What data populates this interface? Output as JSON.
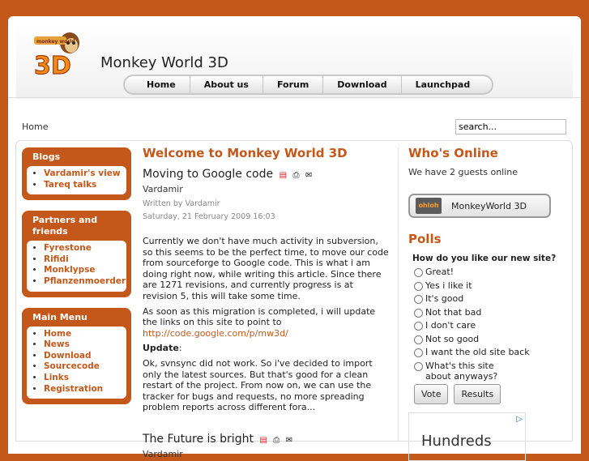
{
  "site": {
    "title": "Monkey World 3D",
    "logo_text": "3D"
  },
  "nav": [
    "Home",
    "About us",
    "Forum",
    "Download",
    "Launchpad"
  ],
  "breadcrumb": "Home",
  "search": {
    "value": "search..."
  },
  "left": {
    "blogs": {
      "title": "Blogs",
      "items": [
        "Vardamir's view",
        "Tareq talks"
      ]
    },
    "partners": {
      "title": "Partners and friends",
      "items": [
        "Fyrestone",
        "Rifidi",
        "Monklypse",
        "Pflanzenmoerder"
      ]
    },
    "menu": {
      "title": "Main Menu",
      "items": [
        "Home",
        "News",
        "Download",
        "Sourcecode",
        "Links",
        "Registration"
      ]
    }
  },
  "main": {
    "heading": "Welcome to Monkey World 3D",
    "article1": {
      "title": "Moving to Google code",
      "author": "Vardamir",
      "written_by": "Written by Vardamir",
      "date": "Saturday, 21 February 2009 16:03",
      "p1": "Currently we don't have much activity in subversion, so this seems to be the perfect time, to move our code from sourceforge to Google code. This is what i am doing right now, while writing this article. Since there are 1271 revisions, and currently progress is at revision 5, this will take some time.",
      "p2_text": "As soon as this migration is completed, i will update the links on this site to point to ",
      "p2_link": "http://code.google.com/p/mw3d/",
      "update_label": "Update",
      "update_colon": ":",
      "p3": "Ok, svnsync did not work. So i've decided to import  only the latest sources. But that's good for a clean restart of the project. From now on, we can use the tracker for bugs and requests, no more spreading problem reports across different fora..."
    },
    "article2": {
      "title": "The Future is bright",
      "author": "Vardamir"
    }
  },
  "right": {
    "online_title": "Who's Online",
    "online_text": "We have 2 guests online",
    "online_button": "MonkeyWorld 3D",
    "online_button_icon": "ohloh",
    "polls_title": "Polls",
    "poll_question": "How do you like our new site?",
    "poll_options": [
      "Great!",
      "Yes i like it",
      "It's good",
      "Not that bad",
      "I don't care",
      "Not so good",
      "I want the old site back",
      "What's this site about anyways?"
    ],
    "vote_label": "Vote",
    "results_label": "Results",
    "ad_text": "Hundreds"
  },
  "colors": {
    "accent": "#c4581a"
  }
}
